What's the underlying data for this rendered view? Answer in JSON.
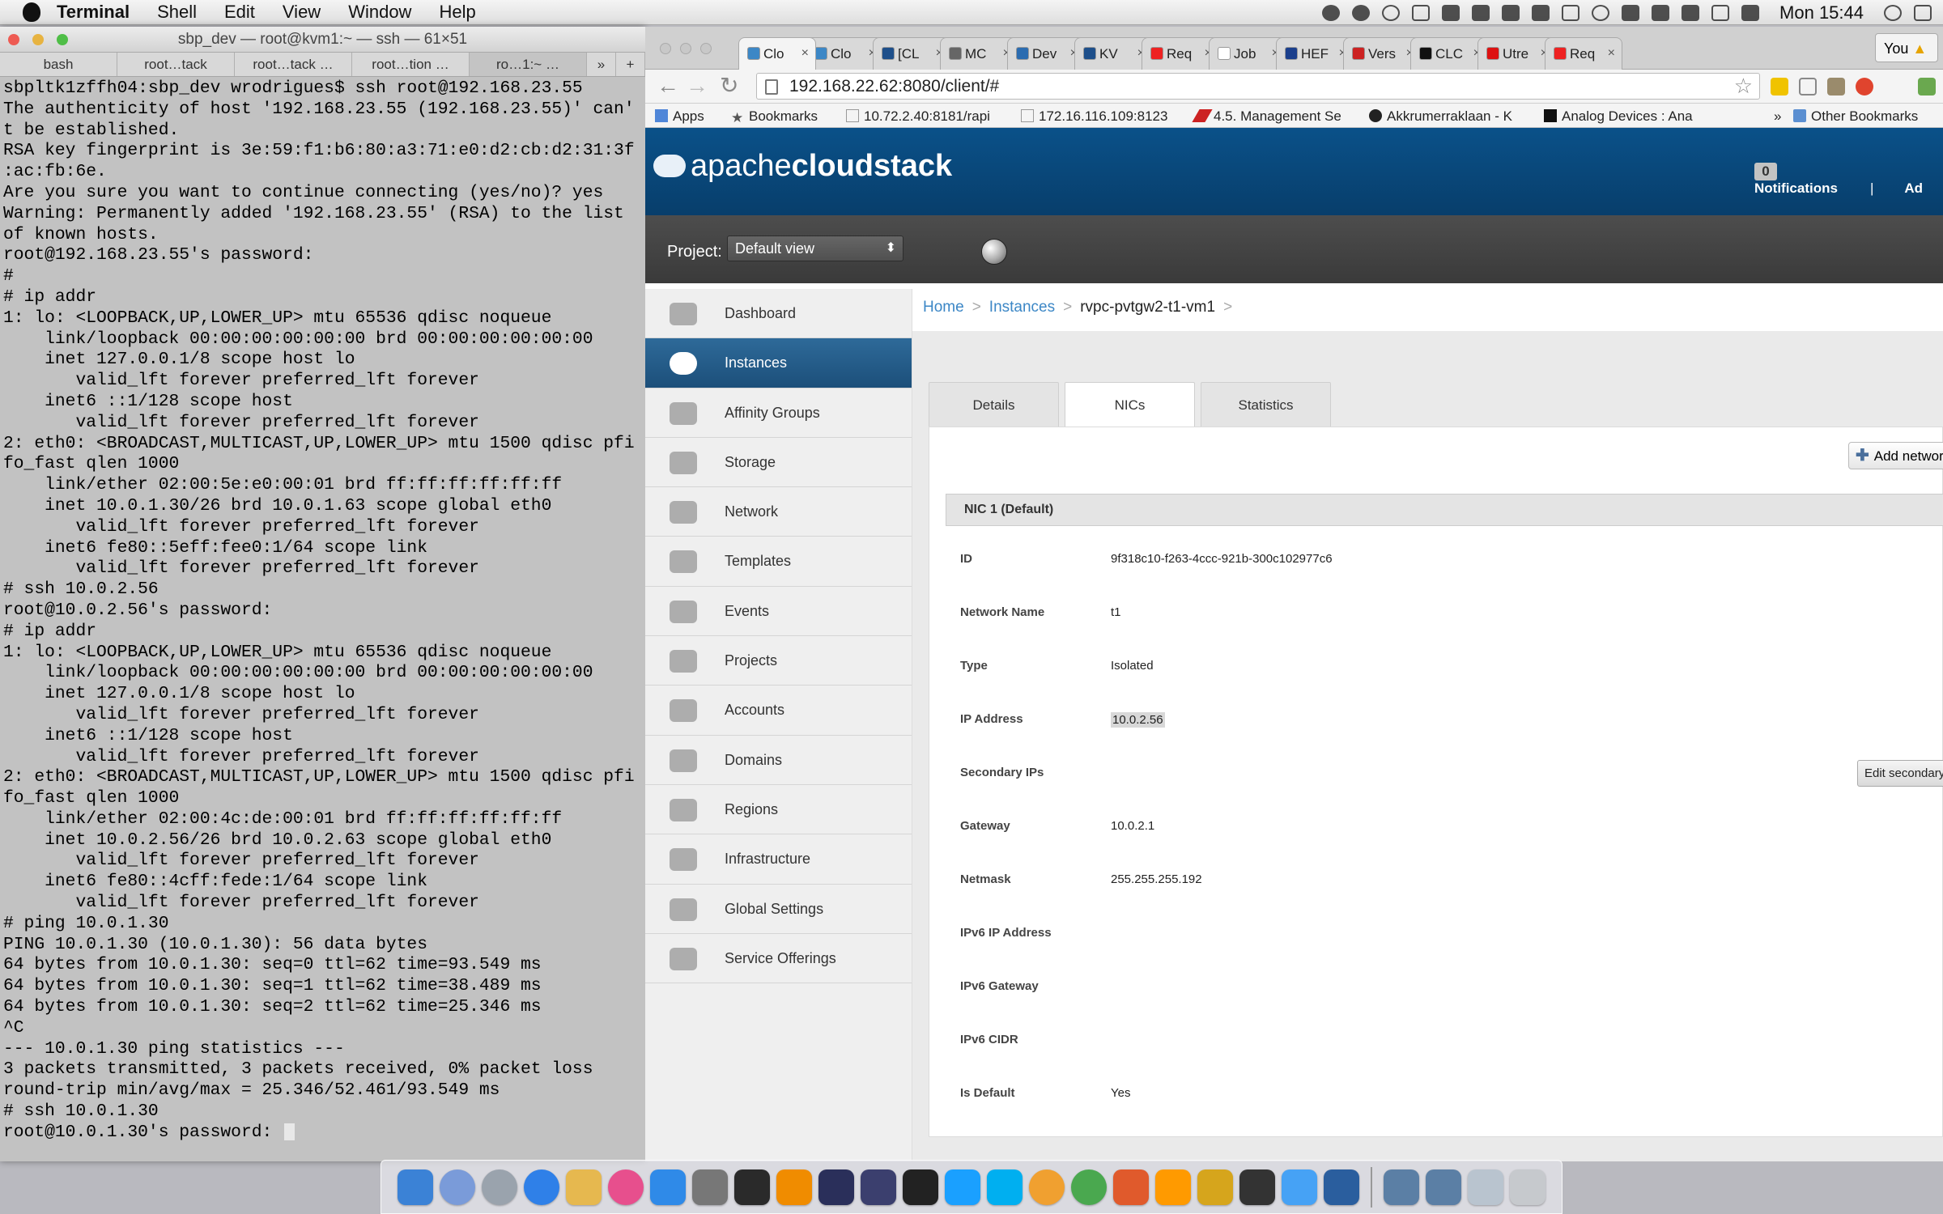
{
  "menubar": {
    "app": "Terminal",
    "items": [
      "Shell",
      "Edit",
      "View",
      "Window",
      "Help"
    ],
    "clock": "Mon 15:44"
  },
  "terminal": {
    "title": "sbp_dev — root@kvm1:~ — ssh — 61×51",
    "tabs": [
      "bash",
      "root…tack",
      "root…tack …",
      "root…tion …",
      "ro…1:~ …"
    ],
    "lines": [
      "sbpltk1zffh04:sbp_dev wrodrigues$ ssh root@192.168.23.55",
      "The authenticity of host '192.168.23.55 (192.168.23.55)' can'",
      "t be established.",
      "RSA key fingerprint is 3e:59:f1:b6:80:a3:71:e0:d2:cb:d2:31:3f",
      ":ac:fb:6e.",
      "Are you sure you want to continue connecting (yes/no)? yes",
      "Warning: Permanently added '192.168.23.55' (RSA) to the list",
      "of known hosts.",
      "root@192.168.23.55's password:",
      "#",
      "# ip addr",
      "1: lo: <LOOPBACK,UP,LOWER_UP> mtu 65536 qdisc noqueue",
      "    link/loopback 00:00:00:00:00:00 brd 00:00:00:00:00:00",
      "    inet 127.0.0.1/8 scope host lo",
      "       valid_lft forever preferred_lft forever",
      "    inet6 ::1/128 scope host",
      "       valid_lft forever preferred_lft forever",
      "2: eth0: <BROADCAST,MULTICAST,UP,LOWER_UP> mtu 1500 qdisc pfi",
      "fo_fast qlen 1000",
      "    link/ether 02:00:5e:e0:00:01 brd ff:ff:ff:ff:ff:ff",
      "    inet 10.0.1.30/26 brd 10.0.1.63 scope global eth0",
      "       valid_lft forever preferred_lft forever",
      "    inet6 fe80::5eff:fee0:1/64 scope link",
      "       valid_lft forever preferred_lft forever",
      "# ssh 10.0.2.56",
      "root@10.0.2.56's password:",
      "# ip addr",
      "1: lo: <LOOPBACK,UP,LOWER_UP> mtu 65536 qdisc noqueue",
      "    link/loopback 00:00:00:00:00:00 brd 00:00:00:00:00:00",
      "    inet 127.0.0.1/8 scope host lo",
      "       valid_lft forever preferred_lft forever",
      "    inet6 ::1/128 scope host",
      "       valid_lft forever preferred_lft forever",
      "2: eth0: <BROADCAST,MULTICAST,UP,LOWER_UP> mtu 1500 qdisc pfi",
      "fo_fast qlen 1000",
      "    link/ether 02:00:4c:de:00:01 brd ff:ff:ff:ff:ff:ff",
      "    inet 10.0.2.56/26 brd 10.0.2.63 scope global eth0",
      "       valid_lft forever preferred_lft forever",
      "    inet6 fe80::4cff:fede:1/64 scope link",
      "       valid_lft forever preferred_lft forever",
      "# ping 10.0.1.30",
      "PING 10.0.1.30 (10.0.1.30): 56 data bytes",
      "64 bytes from 10.0.1.30: seq=0 ttl=62 time=93.549 ms",
      "64 bytes from 10.0.1.30: seq=1 ttl=62 time=38.489 ms",
      "64 bytes from 10.0.1.30: seq=2 ttl=62 time=25.346 ms",
      "^C",
      "--- 10.0.1.30 ping statistics ---",
      "3 packets transmitted, 3 packets received, 0% packet loss",
      "round-trip min/avg/max = 25.346/52.461/93.549 ms",
      "# ssh 10.0.1.30",
      "root@10.0.1.30's password: "
    ]
  },
  "browser": {
    "tabs": [
      {
        "label": "Clo",
        "color": "#3c87c6",
        "active": true
      },
      {
        "label": "Clo",
        "color": "#3c87c6"
      },
      {
        "label": "[CL",
        "color": "#1e4f8a"
      },
      {
        "label": "MC",
        "color": "#666"
      },
      {
        "label": "Dev",
        "color": "#2b6cb0"
      },
      {
        "label": "KV",
        "color": "#1e4f8a"
      },
      {
        "label": "Req",
        "color": "#e22"
      },
      {
        "label": "Job",
        "color": "#fff"
      },
      {
        "label": "HEF",
        "color": "#1b3f8c"
      },
      {
        "label": "Vers",
        "color": "#c22"
      },
      {
        "label": "CLC",
        "color": "#111"
      },
      {
        "label": "Utre",
        "color": "#d11"
      },
      {
        "label": "Req",
        "color": "#e22"
      }
    ],
    "profile": "You",
    "url": "192.168.22.62:8080/client/#",
    "bookmarks": [
      "Apps",
      "Bookmarks",
      "10.72.2.40:8181/rapi",
      "172.16.116.109:8123",
      "4.5. Management Se",
      "Akkrumerraklaan - K",
      "Analog Devices : Ana",
      "»",
      "Other Bookmarks"
    ]
  },
  "cloudstack": {
    "logo": "apachecloudstack",
    "logo_parts": [
      "apache",
      "cloudstack"
    ],
    "notifications_count": "0",
    "notifications_label": "Notifications",
    "separator": "|",
    "account_short": "Ad",
    "project_label": "Project:",
    "project_value": "Default view",
    "nav": [
      "Dashboard",
      "Instances",
      "Affinity Groups",
      "Storage",
      "Network",
      "Templates",
      "Events",
      "Projects",
      "Accounts",
      "Domains",
      "Regions",
      "Infrastructure",
      "Global Settings",
      "Service Offerings"
    ],
    "active_nav": "Instances",
    "breadcrumb": [
      "Home",
      "Instances",
      "rvpc-pvtgw2-t1-vm1"
    ],
    "breadcrumb_sep": ">",
    "detail_tabs": [
      "Details",
      "NICs",
      "Statistics"
    ],
    "active_tab": "NICs",
    "add_network": "Add network",
    "nic_header": "NIC 1 (Default)",
    "edit_secondary": "Edit secondary IPs",
    "fields": [
      {
        "key": "ID",
        "value": "9f318c10-f263-4ccc-921b-300c102977c6"
      },
      {
        "key": "Network Name",
        "value": "t1"
      },
      {
        "key": "Type",
        "value": "Isolated"
      },
      {
        "key": "IP Address",
        "value": "10.0.2.56",
        "highlight": true
      },
      {
        "key": "Secondary IPs",
        "value": ""
      },
      {
        "key": "Gateway",
        "value": "10.0.2.1"
      },
      {
        "key": "Netmask",
        "value": "255.255.255.192"
      },
      {
        "key": "IPv6 IP Address",
        "value": ""
      },
      {
        "key": "IPv6 Gateway",
        "value": ""
      },
      {
        "key": "IPv6 CIDR",
        "value": ""
      },
      {
        "key": "Is Default",
        "value": "Yes"
      }
    ]
  },
  "dock": {
    "apps": [
      "Finder",
      "Launchpad",
      "Rocket",
      "Safari",
      "Preview",
      "iTunes",
      "App Store",
      "System Preferences",
      "Activity Monitor",
      "VLC",
      "Eclipse",
      "Eclipse",
      "Terminal",
      "Slack",
      "Skype",
      "Photos",
      "Chrome",
      "Sublime",
      "Sublime Text",
      "Tree",
      "X11",
      "Messages",
      "QuickTime",
      "Applications",
      "Applications",
      "Downloads",
      "Trash"
    ]
  }
}
